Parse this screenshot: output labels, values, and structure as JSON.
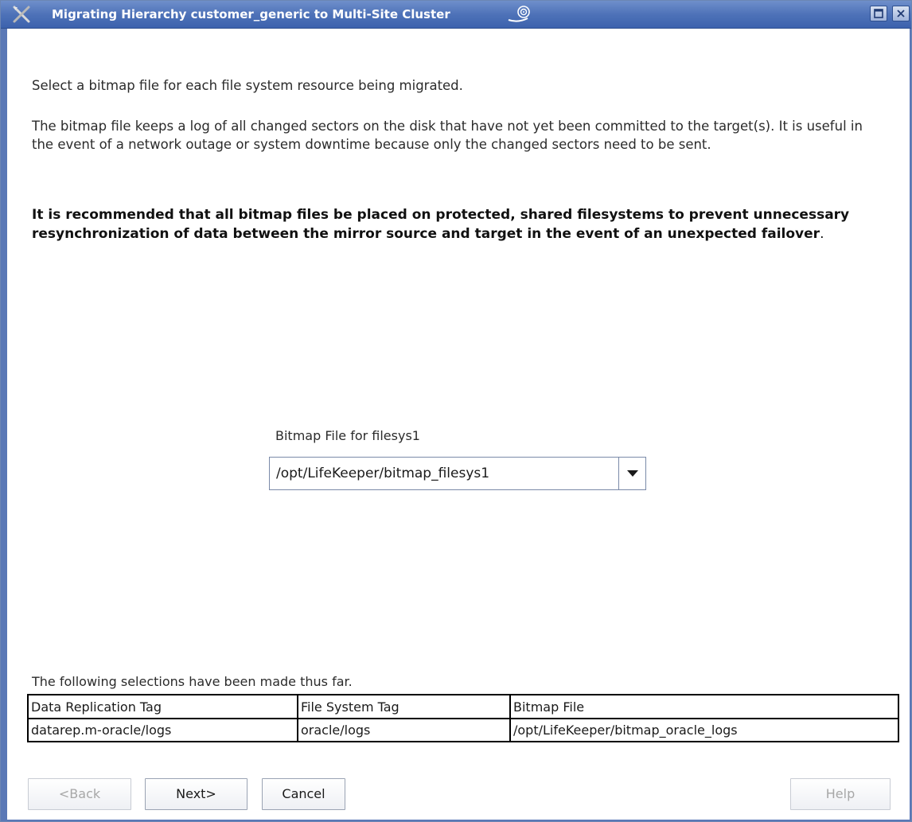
{
  "window": {
    "title": "Migrating Hierarchy customer_generic to Multi-Site Cluster",
    "titlebar_color": "#4e72b8"
  },
  "intro": {
    "line1": "Select a bitmap file for each file system resource being migrated.",
    "line2": "The bitmap file keeps a log of all changed sectors on the disk that have not yet been committed to the target(s). It is useful in the event of a network outage or system downtime because only the changed sectors need to be sent.",
    "recommendation_bold": "It is recommended that all bitmap files be placed on protected, shared filesystems to prevent unnecessary resynchronization of data between the mirror source and target in the event of an unexpected failover",
    "recommendation_tail": "."
  },
  "bitmap_field": {
    "label": "Bitmap File for filesys1",
    "value": "/opt/LifeKeeper/bitmap_filesys1"
  },
  "selections": {
    "caption": "The following selections have been made thus far.",
    "columns": [
      "Data Replication Tag",
      "File System Tag",
      "Bitmap File"
    ],
    "rows": [
      [
        "datarep.m-oracle/logs",
        "oracle/logs",
        "/opt/LifeKeeper/bitmap_oracle_logs"
      ]
    ]
  },
  "buttons": {
    "back": "<Back",
    "next": "Next>",
    "cancel": "Cancel",
    "help": "Help"
  },
  "icons": {
    "app": "tools-x-icon",
    "title_spiral": "spiral-icon",
    "maximize": "maximize-icon",
    "close": "close-icon",
    "dropdown": "chevron-down-icon"
  }
}
